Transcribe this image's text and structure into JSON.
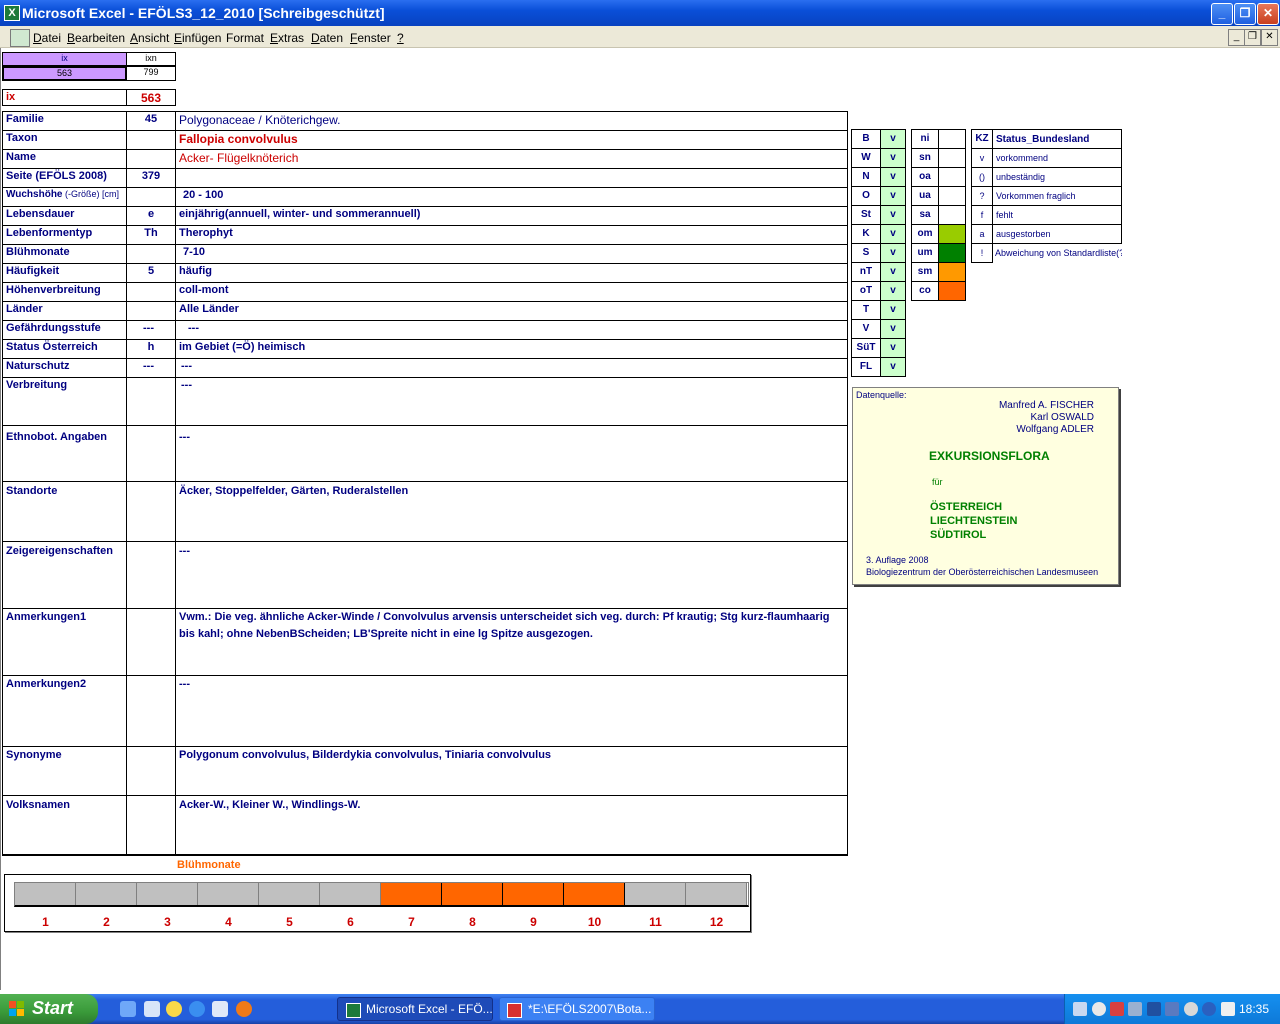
{
  "window": {
    "title": "Microsoft Excel - EFÖLS3_12_2010  [Schreibgeschützt]",
    "app_icon": "excel-x-icon",
    "minimize": "_",
    "maximize": "❐",
    "close": "✕"
  },
  "menu": {
    "items": [
      "Datei",
      "Bearbeiten",
      "Ansicht",
      "Einfügen",
      "Format",
      "Extras",
      "Daten",
      "Fenster",
      "?"
    ],
    "mdi_min": "_",
    "mdi_restore": "❐",
    "mdi_close": "✕"
  },
  "index": {
    "head_ix": "ix",
    "head_ixn": "ixn",
    "val_ix": "563",
    "val_ixn": "799",
    "ix_label": "ix",
    "ix_value": "563"
  },
  "record": {
    "familie": {
      "label": "Familie",
      "code": "45",
      "value": "Polygonaceae  /  Knöterichgew."
    },
    "taxon": {
      "label": "Taxon",
      "code": "",
      "value": "Fallopia convolvulus"
    },
    "name": {
      "label": "Name",
      "code": "",
      "value": "Acker- Flügelknöterich"
    },
    "seite": {
      "label": "Seite (EFÖLS 2008)",
      "code": "379",
      "value": ""
    },
    "wuchs": {
      "label": "Wuchshöhe",
      "label_small": " (-Größe) [cm]",
      "code": "",
      "value": "20 - 100"
    },
    "lebensdauer": {
      "label": "Lebensdauer",
      "code": "e",
      "value": "einjährig(annuell, winter- und sommerannuell)"
    },
    "lebensform": {
      "label": "Lebenformentyp",
      "code": "Th",
      "value": "Therophyt"
    },
    "bluehmonate": {
      "label": "Blühmonate",
      "code": "",
      "value": "7-10"
    },
    "haeufigkeit": {
      "label": "Häufigkeit",
      "code": "5",
      "value": "häufig"
    },
    "hoehen": {
      "label": "Höhenverbreitung",
      "code": "",
      "value": "coll-mont"
    },
    "laender": {
      "label": "Länder",
      "code": "",
      "value": "Alle Länder"
    },
    "gefaehrdung": {
      "label": "Gefährdungsstufe",
      "code": "---",
      "value": "---"
    },
    "status": {
      "label": "Status Österreich",
      "code": "h",
      "value": "im Gebiet (=Ö) heimisch"
    },
    "naturschutz": {
      "label": "Naturschutz",
      "code": "---",
      "value": "---"
    },
    "verbreitung": {
      "label": "Verbreitung",
      "value": "---"
    },
    "ethnobot": {
      "label": "Ethnobot. Angaben",
      "value": "---"
    },
    "standorte": {
      "label": "Standorte",
      "value": "Äcker, Stoppelfelder, Gärten, Ruderalstellen"
    },
    "zeiger": {
      "label": "Zeigereigenschaften",
      "value": "---"
    },
    "anm1": {
      "label": "Anmerkungen1",
      "value": "Vwm.: Die veg. ähnliche Acker-Winde / Convolvulus arvensis unterscheidet sich veg. durch: Pf krautig; Stg kurz-flaumhaarig bis kahl; ohne NebenBScheiden; LB'Spreite nicht in eine lg Spitze ausgezogen."
    },
    "anm2": {
      "label": "Anmerkungen2",
      "value": "---"
    },
    "synonyme": {
      "label": "Synonyme",
      "value": "Polygonum convolvulus, Bilderdykia convolvulus, Tiniaria convolvulus"
    },
    "volksnamen": {
      "label": "Volksnamen",
      "value": "Acker-W., Kleiner W., Windlings-W."
    }
  },
  "states": [
    {
      "code": "B",
      "val": "v"
    },
    {
      "code": "W",
      "val": "v"
    },
    {
      "code": "N",
      "val": "v"
    },
    {
      "code": "O",
      "val": "v"
    },
    {
      "code": "St",
      "val": "v"
    },
    {
      "code": "K",
      "val": "v"
    },
    {
      "code": "S",
      "val": "v"
    },
    {
      "code": "nT",
      "val": "v"
    },
    {
      "code": "oT",
      "val": "v"
    },
    {
      "code": "T",
      "val": "v"
    },
    {
      "code": "V",
      "val": "v"
    },
    {
      "code": "SüT",
      "val": "v"
    },
    {
      "code": "FL",
      "val": "v"
    }
  ],
  "altitude": [
    {
      "code": "ni",
      "color": "#ffffff"
    },
    {
      "code": "sn",
      "color": "#ffffff"
    },
    {
      "code": "oa",
      "color": "#ffffff"
    },
    {
      "code": "ua",
      "color": "#ffffff"
    },
    {
      "code": "sa",
      "color": "#ffffff"
    },
    {
      "code": "om",
      "color": "#99cc00"
    },
    {
      "code": "um",
      "color": "#008000"
    },
    {
      "code": "sm",
      "color": "#ff9900"
    },
    {
      "code": "co",
      "color": "#ff6600"
    }
  ],
  "legend": {
    "head_kz": "KZ",
    "head_status": "Status_Bundesland",
    "rows": [
      {
        "kz": "v",
        "text": "vorkommend"
      },
      {
        "kz": "()",
        "text": "unbeständig"
      },
      {
        "kz": "?",
        "text": "Vorkommen fraglich"
      },
      {
        "kz": "f",
        "text": "fehlt"
      },
      {
        "kz": "a",
        "text": "ausgestorben"
      },
      {
        "kz": "!",
        "text": "Abweichung von Standardliste(?)"
      }
    ]
  },
  "source": {
    "label": "Datenquelle:",
    "authors": [
      "Manfred A. FISCHER",
      "Karl OSWALD",
      "Wolfgang ADLER"
    ],
    "title": "EXKURSIONSFLORA",
    "fuer": "für",
    "regions": [
      "ÖSTERREICH",
      "LIECHTENSTEIN",
      "SÜDTIROL"
    ],
    "edition": "3. Auflage 2008",
    "publisher": "Biologiezentrum der Oberösterreichischen Landesmuseen"
  },
  "chart_data": {
    "type": "bar",
    "title": "Blühmonate",
    "categories": [
      "1",
      "2",
      "3",
      "4",
      "5",
      "6",
      "7",
      "8",
      "9",
      "10",
      "11",
      "12"
    ],
    "values": [
      0,
      0,
      0,
      0,
      0,
      0,
      1,
      1,
      1,
      1,
      0,
      0
    ],
    "active_color": "#ff6600",
    "inactive_color": "#c0c0c0",
    "ylim": [
      0,
      1
    ]
  },
  "taskbar": {
    "start": "Start",
    "tasks": [
      "Microsoft Excel - EFÖ...",
      "*E:\\EFÖLS2007\\Bota..."
    ],
    "clock": "18:35"
  }
}
